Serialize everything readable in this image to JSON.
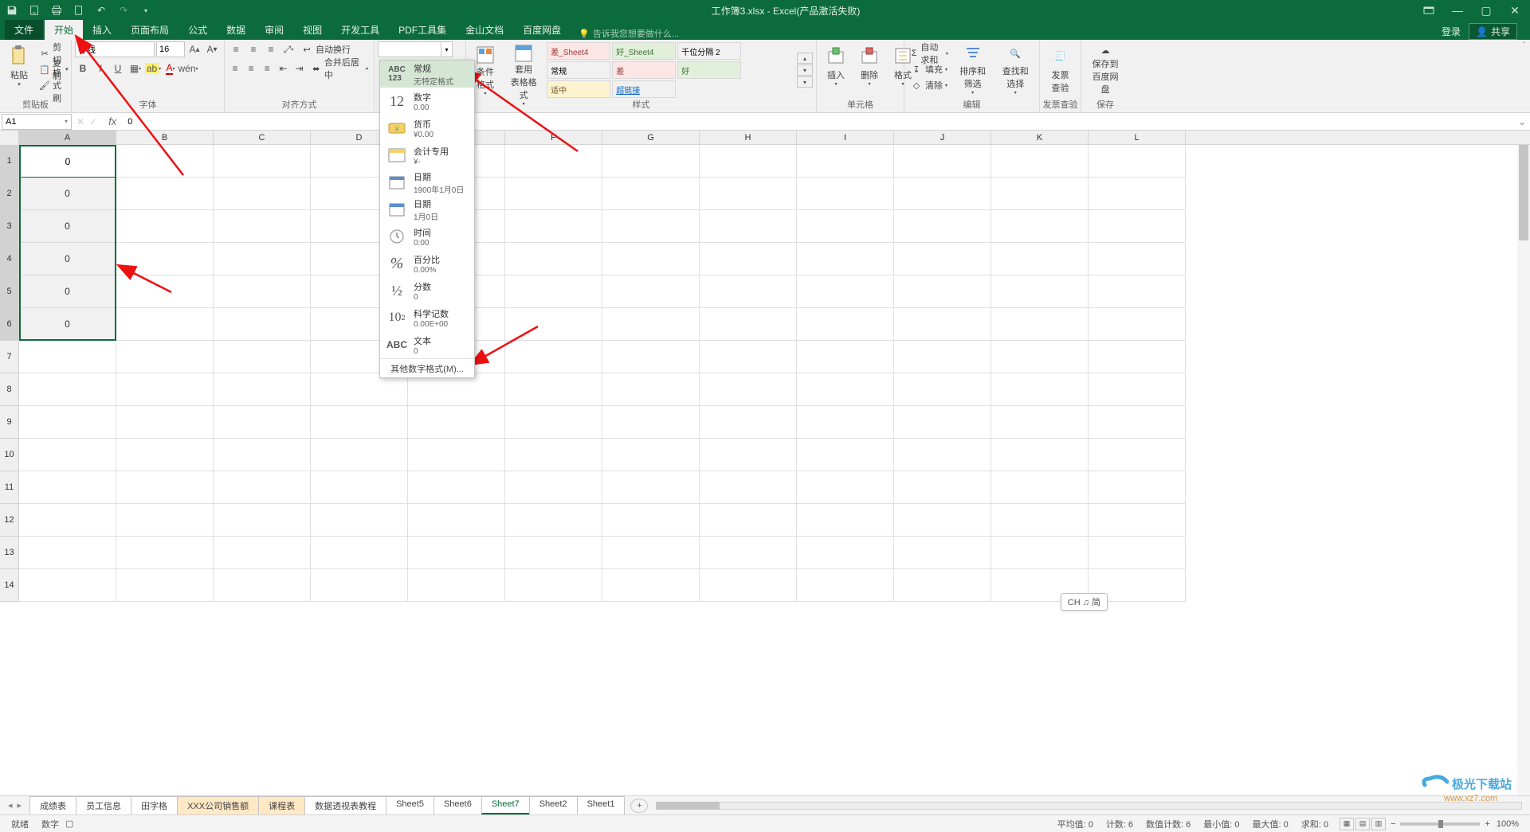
{
  "titlebar": {
    "title": "工作簿3.xlsx - Excel(产品激活失败)"
  },
  "tabs": {
    "file": "文件",
    "home": "开始",
    "insert": "插入",
    "layout": "页面布局",
    "formulas": "公式",
    "data": "数据",
    "review": "审阅",
    "view": "视图",
    "dev": "开发工具",
    "pdf": "PDF工具集",
    "wps": "金山文档",
    "baidu": "百度网盘",
    "tellme_placeholder": "告诉我您想要做什么...",
    "login": "登录",
    "share": "共享"
  },
  "ribbon": {
    "clipboard": {
      "cut": "剪切",
      "copy": "复制",
      "brush": "格式刷",
      "paste": "粘贴",
      "label": "剪贴板"
    },
    "font": {
      "name": "等线",
      "size": "16",
      "label": "字体"
    },
    "align": {
      "wrap": "自动换行",
      "merge": "合并后居中",
      "label": "对齐方式"
    },
    "styles": {
      "cond": "条件\n格式",
      "table": "套用\n表格格式",
      "items": [
        "差_Sheet4",
        "好_Sheet4",
        "千位分隔 2",
        "常规",
        "差",
        "好",
        "适中",
        "超链接"
      ],
      "label": "样式"
    },
    "cells": {
      "insert": "插入",
      "delete": "删除",
      "format": "格式",
      "label": "单元格"
    },
    "editing": {
      "sum": "自动求和",
      "fill": "填充",
      "clear": "清除",
      "sort": "排序和筛选",
      "find": "查找和选择",
      "label": "编辑"
    },
    "invoice": {
      "check": "发票\n查验",
      "label": "发票查验"
    },
    "save": {
      "baidu": "保存到\n百度网盘",
      "label": "保存"
    }
  },
  "number_dropdown": {
    "general": {
      "title": "常规",
      "sub": "无特定格式"
    },
    "number": {
      "title": "数字",
      "sub": "0.00"
    },
    "currency": {
      "title": "货币",
      "sub": "¥0.00"
    },
    "accounting": {
      "title": "会计专用",
      "sub": "¥-"
    },
    "date1": {
      "title": "日期",
      "sub": "1900年1月0日"
    },
    "date2": {
      "title": "日期",
      "sub": "1月0日"
    },
    "time": {
      "title": "时间",
      "sub": "0:00"
    },
    "percent": {
      "title": "百分比",
      "sub": "0.00%"
    },
    "fraction": {
      "title": "分数",
      "sub": "0"
    },
    "scientific": {
      "title": "科学记数",
      "sub": "0.00E+00"
    },
    "text": {
      "title": "文本",
      "sub": "0"
    },
    "more": "其他数字格式(M)..."
  },
  "namebox": {
    "ref": "A1",
    "fx": "fx",
    "formula": "0"
  },
  "columns": [
    "A",
    "B",
    "C",
    "D",
    "E",
    "F",
    "G",
    "H",
    "I",
    "J",
    "K",
    "L"
  ],
  "rows": {
    "count": 14,
    "col_a": [
      "0",
      "0",
      "0",
      "0",
      "0",
      "0"
    ]
  },
  "ime_pill": "CH ♫ 简",
  "sheet_tabs": [
    "成绩表",
    "员工信息",
    "田字格",
    "XXX公司销售额",
    "课程表",
    "数据透视表教程",
    "Sheet5",
    "Sheet6",
    "Sheet7",
    "Sheet2",
    "Sheet1"
  ],
  "active_sheet": "Sheet7",
  "highlighted_sheets": [
    "XXX公司销售额",
    "课程表"
  ],
  "status": {
    "ready": "就绪",
    "mode": "数字",
    "avg": "平均值: 0",
    "count": "计数: 6",
    "numcount": "数值计数: 6",
    "min": "最小值: 0",
    "max": "最大值: 0",
    "sum": "求和: 0",
    "zoom": "100%"
  },
  "watermark": {
    "line1": "极光下载站",
    "line2": "www.xz7.com"
  }
}
